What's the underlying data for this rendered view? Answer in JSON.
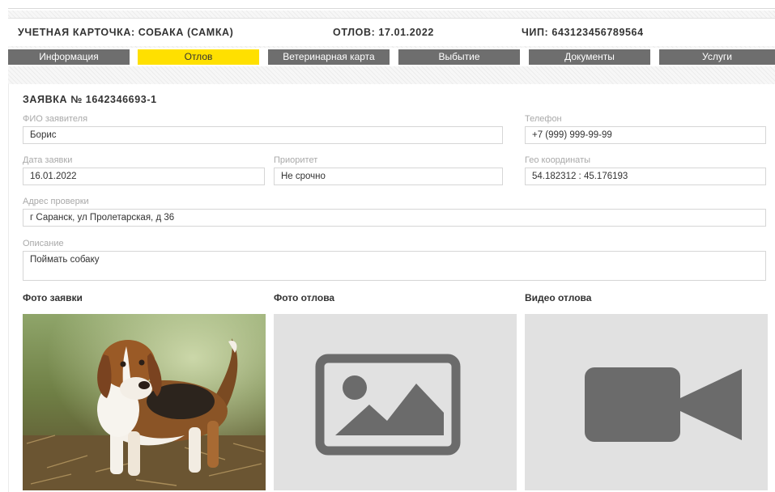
{
  "header": {
    "card_title": "УЧЕТНАЯ КАРТОЧКА: СОБАКА (САМКА)",
    "capture_info": "ОТЛОВ: 17.01.2022",
    "chip_info": "ЧИП: 643123456789564"
  },
  "tabs": [
    {
      "label": "Информация",
      "active": false
    },
    {
      "label": "Отлов",
      "active": true
    },
    {
      "label": "Ветеринарная карта",
      "active": false
    },
    {
      "label": "Выбытие",
      "active": false
    },
    {
      "label": "Документы",
      "active": false
    },
    {
      "label": "Услуги",
      "active": false
    }
  ],
  "request": {
    "title": "ЗАЯВКА № 1642346693-1",
    "applicant_label": "ФИО заявителя",
    "applicant_value": "Борис",
    "phone_label": "Телефон",
    "phone_value": "+7 (999) 999-99-99",
    "date_label": "Дата заявки",
    "date_value": "16.01.2022",
    "priority_label": "Приоритет",
    "priority_value": "Не срочно",
    "geo_label": "Гео координаты",
    "geo_value": "54.182312 : 45.176193",
    "address_label": "Адрес проверки",
    "address_value": "г Саранск, ул Пролетарская, д 36",
    "description_label": "Описание",
    "description_value": "Поймать собаку"
  },
  "media": {
    "request_photo_label": "Фото заявки",
    "capture_photo_label": "Фото отлова",
    "capture_video_label": "Видео отлова",
    "request_photo_icon": "dog-photo",
    "capture_photo_icon": "image-placeholder-icon",
    "capture_video_icon": "video-camera-icon"
  },
  "colors": {
    "active_tab": "#ffe000",
    "tab": "#6e6e6e",
    "placeholder_bg": "#e1e1e1",
    "placeholder_icon": "#6b6b6b"
  }
}
